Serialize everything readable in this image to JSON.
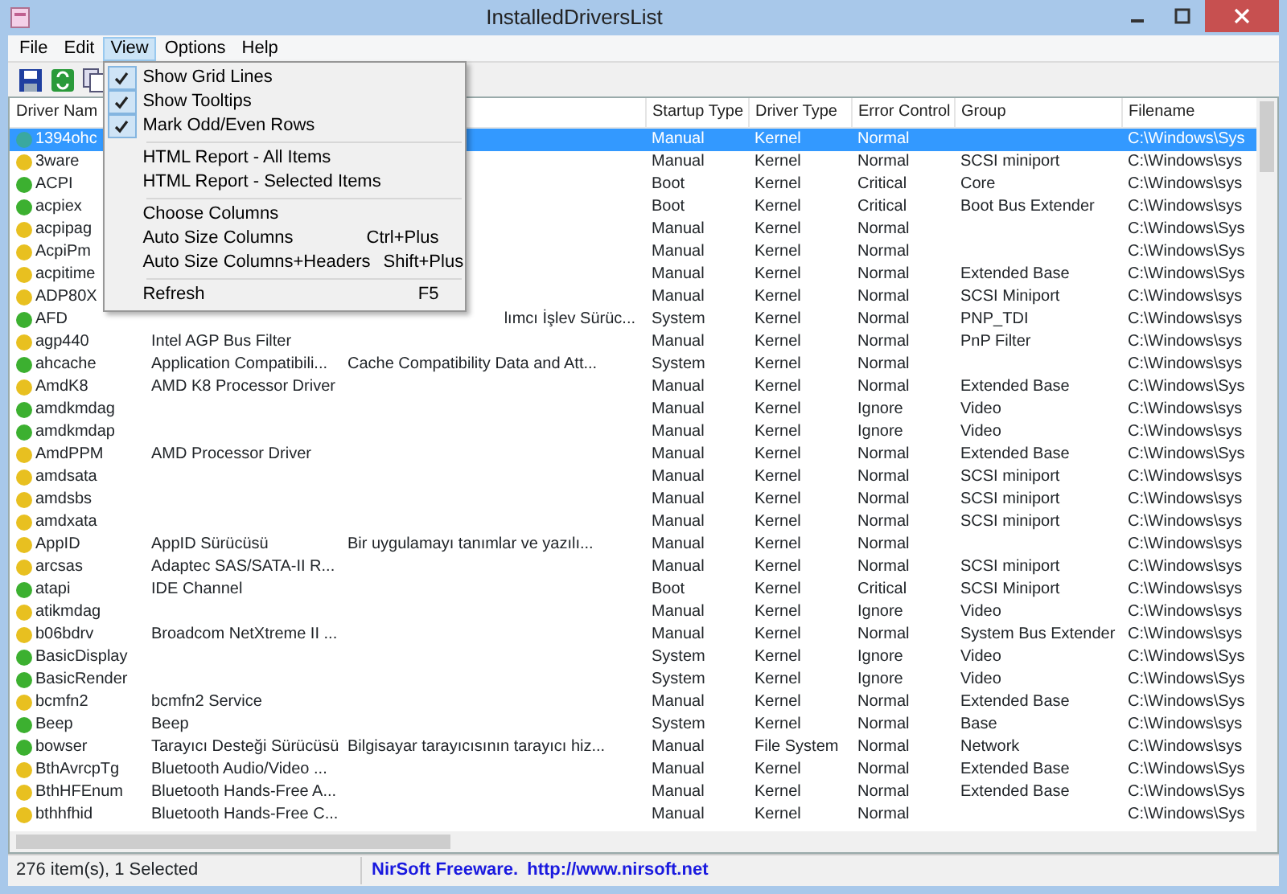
{
  "window": {
    "title": "InstalledDriversList"
  },
  "menu_bar": [
    {
      "label": "File",
      "selected": false
    },
    {
      "label": "Edit",
      "selected": false
    },
    {
      "label": "View",
      "selected": true
    },
    {
      "label": "Options",
      "selected": false
    },
    {
      "label": "Help",
      "selected": false
    }
  ],
  "view_menu": [
    {
      "kind": "check",
      "label": "Show Grid Lines",
      "checked": true
    },
    {
      "kind": "check",
      "label": "Show Tooltips",
      "checked": true
    },
    {
      "kind": "check",
      "label": "Mark Odd/Even Rows",
      "checked": true
    },
    {
      "kind": "separator"
    },
    {
      "kind": "item",
      "label": "HTML Report - All Items"
    },
    {
      "kind": "item",
      "label": "HTML Report - Selected Items"
    },
    {
      "kind": "separator"
    },
    {
      "kind": "item",
      "label": "Choose Columns"
    },
    {
      "kind": "item",
      "label": "Auto Size Columns",
      "shortcut": "Ctrl+Plus"
    },
    {
      "kind": "item",
      "label": "Auto Size Columns+Headers",
      "shortcut": "Shift+Plus"
    },
    {
      "kind": "separator"
    },
    {
      "kind": "item",
      "label": "Refresh",
      "shortcut": "F5"
    }
  ],
  "table": {
    "columns": [
      "Driver Nam",
      "",
      "",
      "Startup Type",
      "Driver Type",
      "Error Control",
      "Group",
      "Filename"
    ],
    "rows": [
      {
        "selected": true,
        "color": "#3aa8a0",
        "cells": [
          "1394ohc",
          "",
          "",
          "Manual",
          "Kernel",
          "Normal",
          "",
          "C:\\Windows\\Sys"
        ]
      },
      {
        "selected": false,
        "color": "#e8c020",
        "cells": [
          "3ware",
          "",
          "",
          "Manual",
          "Kernel",
          "Normal",
          "SCSI miniport",
          "C:\\Windows\\sys"
        ]
      },
      {
        "selected": false,
        "color": "#3cb030",
        "cells": [
          "ACPI",
          "",
          "",
          "Boot",
          "Kernel",
          "Critical",
          "Core",
          "C:\\Windows\\sys"
        ]
      },
      {
        "selected": false,
        "color": "#3cb030",
        "cells": [
          "acpiex",
          "",
          "",
          "Boot",
          "Kernel",
          "Critical",
          "Boot Bus Extender",
          "C:\\Windows\\sys"
        ]
      },
      {
        "selected": false,
        "color": "#e8c020",
        "cells": [
          "acpipag",
          "",
          "",
          "Manual",
          "Kernel",
          "Normal",
          "",
          "C:\\Windows\\Sys"
        ]
      },
      {
        "selected": false,
        "color": "#e8c020",
        "cells": [
          "AcpiPm",
          "",
          "",
          "Manual",
          "Kernel",
          "Normal",
          "",
          "C:\\Windows\\Sys"
        ]
      },
      {
        "selected": false,
        "color": "#e8c020",
        "cells": [
          "acpitime",
          "",
          "",
          "Manual",
          "Kernel",
          "Normal",
          "Extended Base",
          "C:\\Windows\\Sys"
        ]
      },
      {
        "selected": false,
        "color": "#e8c020",
        "cells": [
          "ADP80X",
          "",
          "",
          "Manual",
          "Kernel",
          "Normal",
          "SCSI Miniport",
          "C:\\Windows\\sys"
        ]
      },
      {
        "selected": false,
        "color": "#3cb030",
        "cells": [
          "AFD",
          "",
          "lımcı İşlev Sürüc...",
          "System",
          "Kernel",
          "Normal",
          "PNP_TDI",
          "C:\\Windows\\sys"
        ]
      },
      {
        "selected": false,
        "color": "#e8c020",
        "cells": [
          "agp440",
          "Intel AGP Bus Filter",
          "",
          "Manual",
          "Kernel",
          "Normal",
          "PnP Filter",
          "C:\\Windows\\sys"
        ]
      },
      {
        "selected": false,
        "color": "#3cb030",
        "cells": [
          "ahcache",
          "Application Compatibili...",
          "Cache Compatibility Data and Att...",
          "System",
          "Kernel",
          "Normal",
          "",
          "C:\\Windows\\sys"
        ]
      },
      {
        "selected": false,
        "color": "#e8c020",
        "cells": [
          "AmdK8",
          "AMD K8 Processor Driver",
          "",
          "Manual",
          "Kernel",
          "Normal",
          "Extended Base",
          "C:\\Windows\\Sys"
        ]
      },
      {
        "selected": false,
        "color": "#3cb030",
        "cells": [
          "amdkmdag",
          "",
          "",
          "Manual",
          "Kernel",
          "Ignore",
          "Video",
          "C:\\Windows\\sys"
        ]
      },
      {
        "selected": false,
        "color": "#3cb030",
        "cells": [
          "amdkmdap",
          "",
          "",
          "Manual",
          "Kernel",
          "Ignore",
          "Video",
          "C:\\Windows\\sys"
        ]
      },
      {
        "selected": false,
        "color": "#e8c020",
        "cells": [
          "AmdPPM",
          "AMD Processor Driver",
          "",
          "Manual",
          "Kernel",
          "Normal",
          "Extended Base",
          "C:\\Windows\\Sys"
        ]
      },
      {
        "selected": false,
        "color": "#e8c020",
        "cells": [
          "amdsata",
          "",
          "",
          "Manual",
          "Kernel",
          "Normal",
          "SCSI miniport",
          "C:\\Windows\\sys"
        ]
      },
      {
        "selected": false,
        "color": "#e8c020",
        "cells": [
          "amdsbs",
          "",
          "",
          "Manual",
          "Kernel",
          "Normal",
          "SCSI miniport",
          "C:\\Windows\\sys"
        ]
      },
      {
        "selected": false,
        "color": "#e8c020",
        "cells": [
          "amdxata",
          "",
          "",
          "Manual",
          "Kernel",
          "Normal",
          "SCSI miniport",
          "C:\\Windows\\sys"
        ]
      },
      {
        "selected": false,
        "color": "#e8c020",
        "cells": [
          "AppID",
          "AppID Sürücüsü",
          "Bir uygulamayı tanımlar ve yazılı...",
          "Manual",
          "Kernel",
          "Normal",
          "",
          "C:\\Windows\\sys"
        ]
      },
      {
        "selected": false,
        "color": "#e8c020",
        "cells": [
          "arcsas",
          "Adaptec SAS/SATA-II R...",
          "",
          "Manual",
          "Kernel",
          "Normal",
          "SCSI miniport",
          "C:\\Windows\\sys"
        ]
      },
      {
        "selected": false,
        "color": "#3cb030",
        "cells": [
          "atapi",
          "IDE Channel",
          "",
          "Boot",
          "Kernel",
          "Critical",
          "SCSI Miniport",
          "C:\\Windows\\sys"
        ]
      },
      {
        "selected": false,
        "color": "#e8c020",
        "cells": [
          "atikmdag",
          "",
          "",
          "Manual",
          "Kernel",
          "Ignore",
          "Video",
          "C:\\Windows\\sys"
        ]
      },
      {
        "selected": false,
        "color": "#e8c020",
        "cells": [
          "b06bdrv",
          "Broadcom NetXtreme II ...",
          "",
          "Manual",
          "Kernel",
          "Normal",
          "System Bus Extender",
          "C:\\Windows\\sys"
        ]
      },
      {
        "selected": false,
        "color": "#3cb030",
        "cells": [
          "BasicDisplay",
          "",
          "",
          "System",
          "Kernel",
          "Ignore",
          "Video",
          "C:\\Windows\\Sys"
        ]
      },
      {
        "selected": false,
        "color": "#3cb030",
        "cells": [
          "BasicRender",
          "",
          "",
          "System",
          "Kernel",
          "Ignore",
          "Video",
          "C:\\Windows\\Sys"
        ]
      },
      {
        "selected": false,
        "color": "#e8c020",
        "cells": [
          "bcmfn2",
          "bcmfn2 Service",
          "",
          "Manual",
          "Kernel",
          "Normal",
          "Extended Base",
          "C:\\Windows\\Sys"
        ]
      },
      {
        "selected": false,
        "color": "#3cb030",
        "cells": [
          "Beep",
          "Beep",
          "",
          "System",
          "Kernel",
          "Normal",
          "Base",
          "C:\\Windows\\sys"
        ]
      },
      {
        "selected": false,
        "color": "#3cb030",
        "cells": [
          "bowser",
          "Tarayıcı Desteği Sürücüsü",
          "Bilgisayar tarayıcısının tarayıcı hiz...",
          "Manual",
          "File System",
          "Normal",
          "Network",
          "C:\\Windows\\sys"
        ]
      },
      {
        "selected": false,
        "color": "#e8c020",
        "cells": [
          "BthAvrcpTg",
          "Bluetooth Audio/Video ...",
          "",
          "Manual",
          "Kernel",
          "Normal",
          "Extended Base",
          "C:\\Windows\\Sys"
        ]
      },
      {
        "selected": false,
        "color": "#e8c020",
        "cells": [
          "BthHFEnum",
          "Bluetooth Hands-Free A...",
          "",
          "Manual",
          "Kernel",
          "Normal",
          "Extended Base",
          "C:\\Windows\\Sys"
        ]
      },
      {
        "selected": false,
        "color": "#e8c020",
        "cells": [
          "bthhfhid",
          "Bluetooth Hands-Free C...",
          "",
          "Manual",
          "Kernel",
          "Normal",
          "",
          "C:\\Windows\\Sys"
        ]
      }
    ]
  },
  "status_bar": {
    "count": "276 item(s), 1 Selected",
    "credit": "NirSoft Freeware.",
    "url": "http://www.nirsoft.net"
  }
}
